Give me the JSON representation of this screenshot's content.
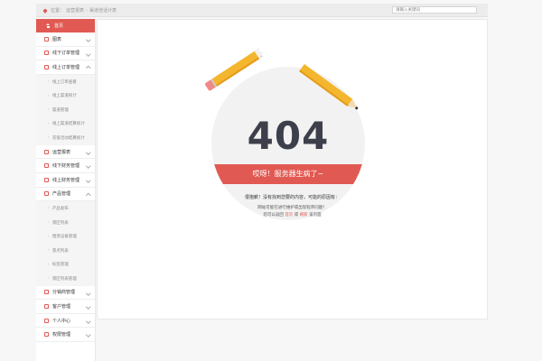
{
  "header": {
    "breadcrumb": [
      "位置：",
      "运营报表",
      "渠道佳话计表"
    ],
    "search_placeholder": "请输入关键词"
  },
  "sidebar": {
    "home_label": "首页",
    "sections": [
      {
        "label": "图表",
        "icon": "chart-icon",
        "expanded": false
      },
      {
        "label": "线下订单管理",
        "icon": "order-icon",
        "expanded": false
      },
      {
        "label": "线上订单管理",
        "icon": "monitor-icon",
        "expanded": true,
        "items": [
          "线上订单查看",
          "线上渠道统计",
          "渠道管理",
          "线上渠道结算统计",
          "充值活动结算统计"
        ]
      },
      {
        "label": "运营报表",
        "icon": "report-icon",
        "expanded": false
      },
      {
        "label": "线下财务管理",
        "icon": "finance-icon",
        "expanded": false
      },
      {
        "label": "线上财务管理",
        "icon": "finance-online-icon",
        "expanded": false
      },
      {
        "label": "产品管理",
        "icon": "product-icon",
        "expanded": true,
        "items": [
          "产品发布",
          "景区列表",
          "租赁设备管理",
          "景点列表",
          "标签管理",
          "景区列表管理"
        ]
      },
      {
        "label": "分销商管理",
        "icon": "distributor-icon",
        "expanded": false
      },
      {
        "label": "客户管理",
        "icon": "customer-icon",
        "expanded": false
      },
      {
        "label": "个人中心",
        "icon": "user-icon",
        "expanded": false
      },
      {
        "label": "权限管理",
        "icon": "permission-icon",
        "expanded": false
      }
    ]
  },
  "error": {
    "code": "404",
    "ribbon": "哎呀！服务器生病了~",
    "line1": "很抱歉！没有找到您要的内容，可能的原因有：",
    "line2": "网站可能在进行维护或出现程序问题！",
    "line3_prefix": "您可以返回",
    "link_home": "首页",
    "line3_or": "或",
    "link_refresh": "刷新",
    "line3_suffix": "该页面"
  },
  "colors": {
    "accent": "#e05a53",
    "pencil": "#f4b62f",
    "text_dark": "#3d3f4a"
  }
}
